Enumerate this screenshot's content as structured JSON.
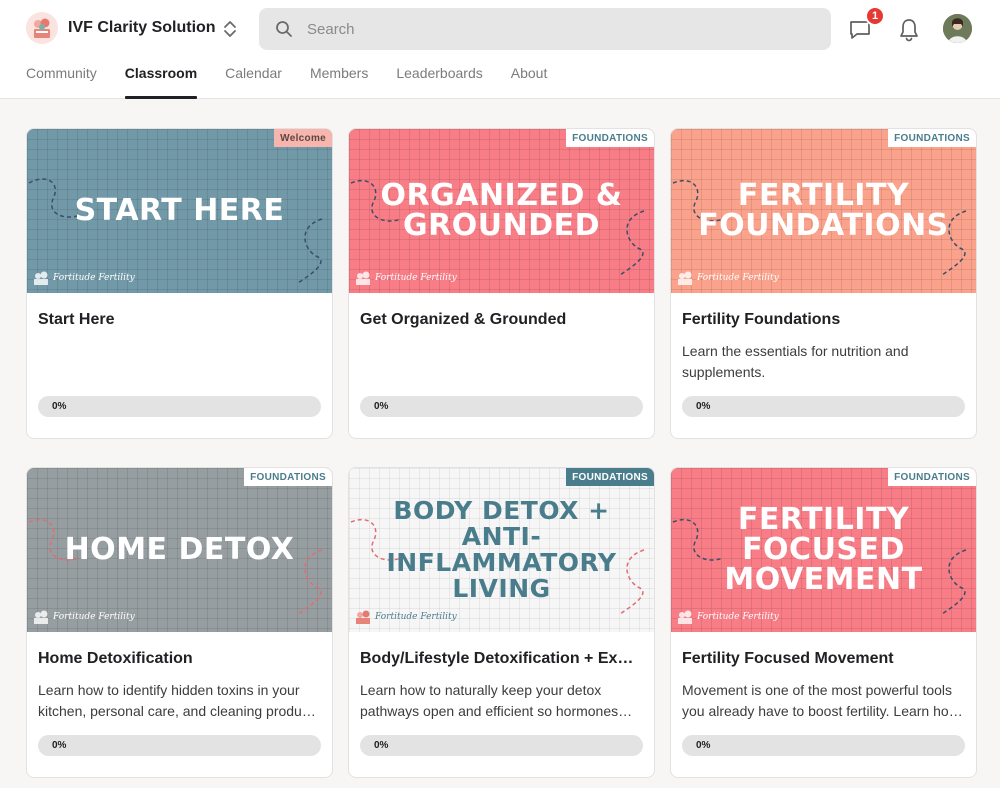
{
  "header": {
    "brand_name": "IVF Clarity Solution",
    "search_placeholder": "Search",
    "chat_badge": "1",
    "icons": [
      "brand-logo",
      "switch-icon",
      "search-icon",
      "chat-icon",
      "bell-icon",
      "user-avatar"
    ]
  },
  "nav": {
    "tabs": [
      {
        "label": "Community",
        "active": false
      },
      {
        "label": "Classroom",
        "active": true
      },
      {
        "label": "Calendar",
        "active": false
      },
      {
        "label": "Members",
        "active": false
      },
      {
        "label": "Leaderboards",
        "active": false
      },
      {
        "label": "About",
        "active": false
      }
    ]
  },
  "courses": [
    {
      "cover_title": "START HERE",
      "tag": "Welcome",
      "cover_color": "#7199a8",
      "logo_text": "Fortitude Fertility",
      "title": "Start Here",
      "description": "",
      "progress_label": "0%",
      "progress": 0
    },
    {
      "cover_title": "ORGANIZED & GROUNDED",
      "tag": "FOUNDATIONS",
      "cover_color": "#f87d86",
      "logo_text": "Fortitude Fertility",
      "title": "Get Organized & Grounded",
      "description": "",
      "progress_label": "0%",
      "progress": 0
    },
    {
      "cover_title": "FERTILITY FOUNDATIONS",
      "tag": "FOUNDATIONS",
      "cover_color": "#fba28c",
      "logo_text": "Fortitude Fertility",
      "title": "Fertility Foundations",
      "description": "Learn the essentials for nutrition and supplements.",
      "progress_label": "0%",
      "progress": 0
    },
    {
      "cover_title": "HOME DETOX",
      "tag": "FOUNDATIONS",
      "cover_color": "#979ea1",
      "logo_text": "Fortitude Fertility",
      "title": "Home Detoxification",
      "description": "Learn how to identify hidden toxins in your kitchen, personal care, and cleaning products and how to swap them out.",
      "progress_label": "0%",
      "progress": 0
    },
    {
      "cover_title": "BODY DETOX + ANTI-INFLAMMATORY LIVING",
      "tag": "FOUNDATIONS",
      "cover_color": "#f6f6f6",
      "logo_text": "Fortitude Fertility",
      "title": "Body/Lifestyle Detoxification + Ex…",
      "description": "Learn how to naturally keep your detox pathways open and efficient so hormones can be processed properly.",
      "progress_label": "0%",
      "progress": 0
    },
    {
      "cover_title": "FERTILITY FOCUSED MOVEMENT",
      "tag": "FOUNDATIONS",
      "cover_color": "#f87d86",
      "logo_text": "Fortitude Fertility",
      "title": "Fertility Focused Movement",
      "description": "Movement is one of the most powerful tools you already have to boost fertility. Learn how to move for your cycle.",
      "progress_label": "0%",
      "progress": 0
    }
  ]
}
